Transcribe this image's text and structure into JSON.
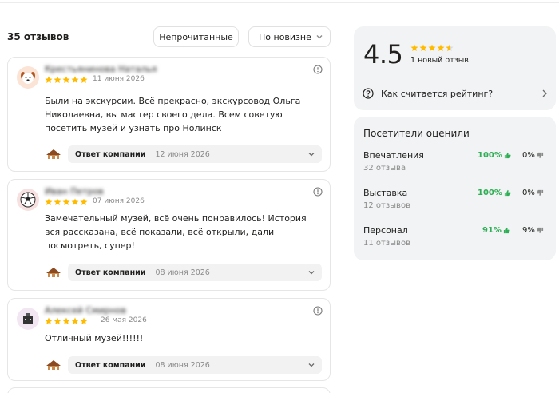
{
  "reviews_header": {
    "count": "35 отзывов",
    "filter_unread": "Непрочитанные",
    "sort_selected": "По новизне"
  },
  "reviews": [
    {
      "author": "Крестьянинова Наталья",
      "date": "11 июня 2026",
      "rating": 5,
      "text": "Были на экскурсии. Всё прекрасно, экскурсовод Ольга Николаевна, вы мастер своего дела. Всем советую посетить музей и узнать про Нолинск",
      "answer_label": "Ответ компании",
      "answer_date": "12 июня 2026"
    },
    {
      "author": "Иван Петров",
      "date": "07 июня 2026",
      "rating": 5,
      "text": "Замечательный музей, всё очень понравилось! История вся рассказана, всё показали, всё открыли, дали посмотреть, супер!",
      "answer_label": "Ответ компании",
      "answer_date": "08 июня 2026"
    },
    {
      "author": "Алексей Смирнов",
      "date": "26 мая 2026",
      "rating": 5,
      "text": "Отличный музей!!!!!!",
      "answer_label": "Ответ компании",
      "answer_date": "08 июня 2026"
    }
  ],
  "rating_panel": {
    "value": "4.5",
    "stars": 4.5,
    "new_reviews": "1 новый отзыв",
    "how_calculated": "Как считается рейтинг?"
  },
  "aspects_panel": {
    "title": "Посетители оценили",
    "items": [
      {
        "name": "Впечатления",
        "count": "32 отзыва",
        "positive": "100%",
        "negative": "0%"
      },
      {
        "name": "Выставка",
        "count": "12 отзывов",
        "positive": "100%",
        "negative": "0%"
      },
      {
        "name": "Персонал",
        "count": "11 отзывов",
        "positive": "91%",
        "negative": "9%"
      }
    ]
  },
  "colors": {
    "star": "#ffbb00",
    "positive": "#2eae55",
    "panel_bg": "#f2f3f4",
    "answer_bg": "#f2f2f2"
  }
}
